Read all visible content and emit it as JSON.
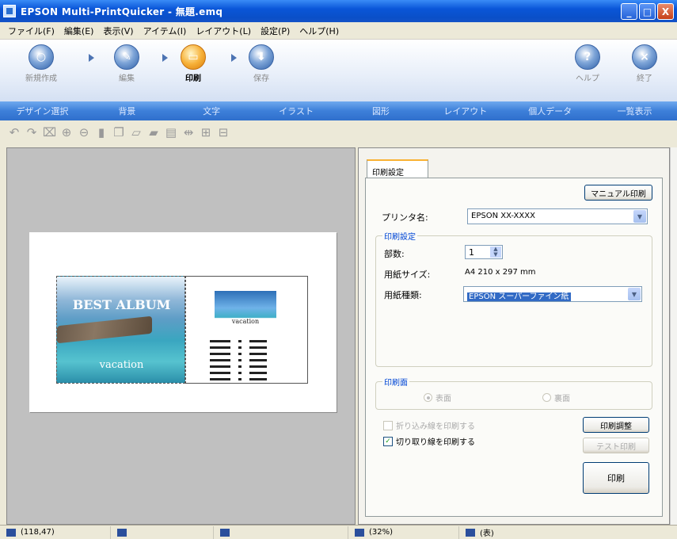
{
  "window": {
    "title": "EPSON Multi-PrintQuicker - 無題.emq",
    "min": "_",
    "max": "□",
    "close": "X"
  },
  "menu": [
    "ファイル(F)",
    "編集(E)",
    "表示(V)",
    "アイテム(I)",
    "レイアウト(L)",
    "設定(P)",
    "ヘルプ(H)"
  ],
  "steps": [
    {
      "label": "新規作成",
      "icon": "new-icon"
    },
    {
      "label": "編集",
      "icon": "edit-icon"
    },
    {
      "label": "印刷",
      "icon": "print-icon",
      "active": true
    },
    {
      "label": "保存",
      "icon": "save-icon"
    }
  ],
  "help": {
    "label": "ヘルプ",
    "glyph": "?"
  },
  "exit": {
    "label": "終了",
    "glyph": "×"
  },
  "tabs": [
    "デザイン選択",
    "背景",
    "文字",
    "イラスト",
    "図形",
    "レイアウト",
    "個人データ",
    "一覧表示"
  ],
  "preview": {
    "best_album": "BEST ALBUM",
    "vacation": "vacation",
    "mini_title": "vacation"
  },
  "print_panel": {
    "tab": "印刷設定",
    "manual_print": "マニュアル印刷",
    "printer_label": "プリンタ名:",
    "printer_value": "EPSON XX-XXXX",
    "group_settings": "印刷設定",
    "copies_label": "部数:",
    "copies_value": "1",
    "paper_size_label": "用紙サイズ:",
    "paper_size_value": "A4 210 x 297 mm",
    "paper_type_label": "用紙種類:",
    "paper_type_value": "EPSON スーパーファイン紙",
    "group_side": "印刷面",
    "side_front": "表面",
    "side_back": "裏面",
    "fold_line": "折り込み線を印刷する",
    "cut_line": "切り取り線を印刷する",
    "adjust": "印刷調整",
    "test_print": "テスト印刷",
    "print": "印刷"
  },
  "status": {
    "coords": "(118,47)",
    "zoom": "(32%)",
    "side": "(表)"
  }
}
